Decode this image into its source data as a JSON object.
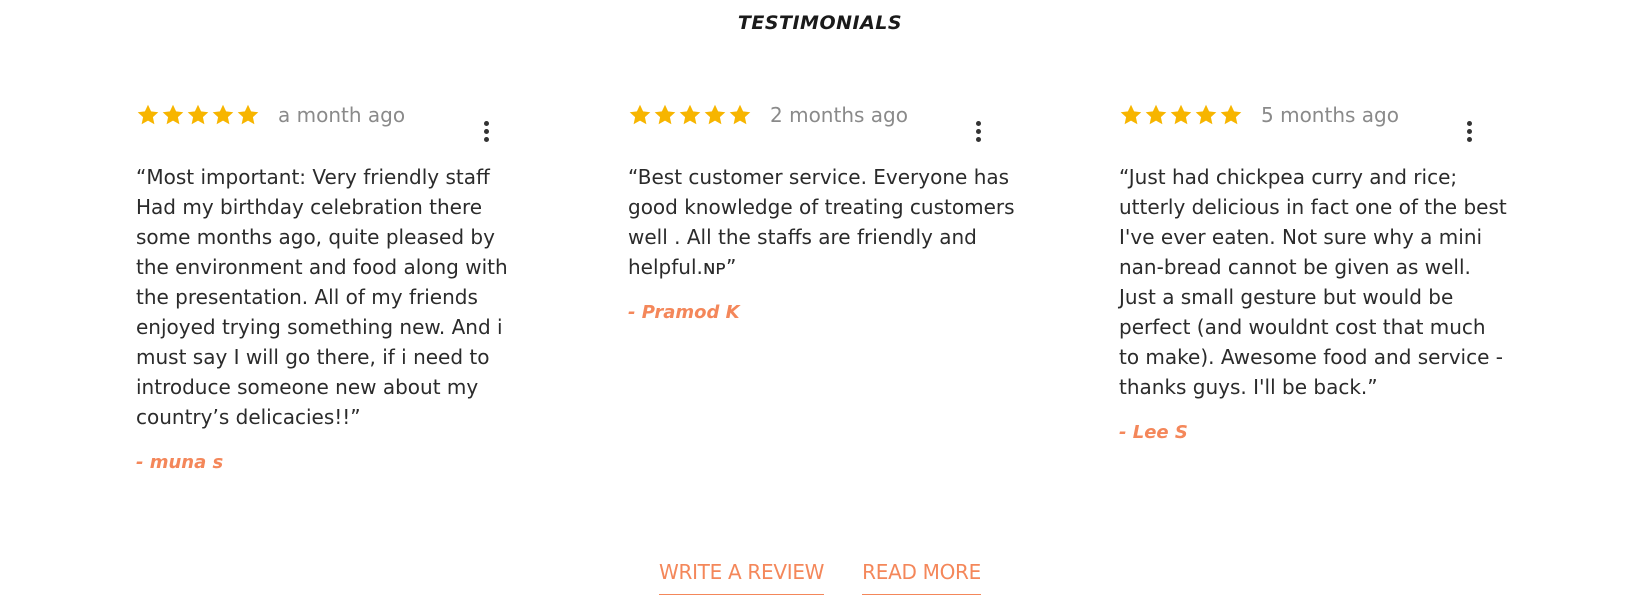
{
  "section": {
    "title": "TESTIMONIALS"
  },
  "colors": {
    "star": "#F7B500",
    "accent": "#F4875A",
    "text": "#2B2B2B",
    "muted": "#8A8A8A"
  },
  "reviews": [
    {
      "rating": 5,
      "time_ago": "a month ago",
      "quote": "“Most important: Very friendly staff Had my birthday celebration there some months ago, quite pleased by the environment and food along with the presentation. All of my friends enjoyed trying something new. And i must say I will go there, if i need to introduce someone new about my country’s delicacies!!”",
      "author": "- muna s"
    },
    {
      "rating": 5,
      "time_ago": "2 months ago",
      "quote": "“Best customer service. Everyone has good knowledge of treating customers well . All the staffs are friendly and helpful.ɴᴘ”",
      "author": "- Pramod K"
    },
    {
      "rating": 5,
      "time_ago": "5 months ago",
      "quote": "“Just had chickpea curry and rice; utterly delicious in fact one of the best I've ever eaten. Not sure why a mini nan-bread cannot be given as well. Just a small gesture but would be perfect (and wouldnt cost that much to make). Awesome food and service - thanks guys. I'll be back.”",
      "author": "- Lee S"
    }
  ],
  "actions": {
    "write_review": "WRITE A REVIEW",
    "read_more": "READ MORE"
  }
}
